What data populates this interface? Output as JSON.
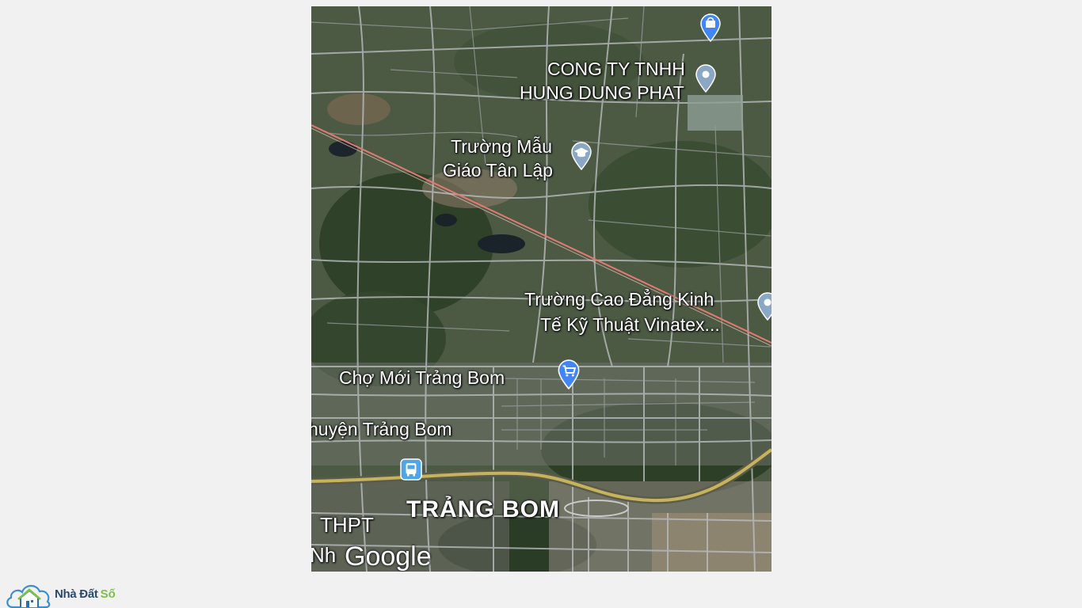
{
  "map": {
    "labels": {
      "company_line1": "CONG TY TNHH",
      "company_line2": "HUNG DUNG PHAT",
      "school_line1": "Trường Mẫu",
      "school_line2": "Giáo Tân Lập",
      "college_line1": "Trường Cao Đẳng Kinh",
      "college_line2": "Tế Kỹ Thuật Vinatex...",
      "market": "Chợ Mới Trảng Bom",
      "district": "huyện Trảng Bom",
      "town": "TRẢNG BOM",
      "highschool": "THPT",
      "highschool_cut": "Nh"
    },
    "attribution": "Google",
    "icons": [
      "shopping-pin-icon",
      "place-pin-icon",
      "school-pin-icon",
      "place-pin-icon",
      "cart-pin-icon",
      "bus-stop-icon"
    ]
  },
  "brand": {
    "name_part1": "Nhà Đất",
    "name_part2": "Số",
    "icon": "house-cloud-logo",
    "colors": {
      "blue": "#2b4a6b",
      "green": "#7cc242"
    }
  }
}
